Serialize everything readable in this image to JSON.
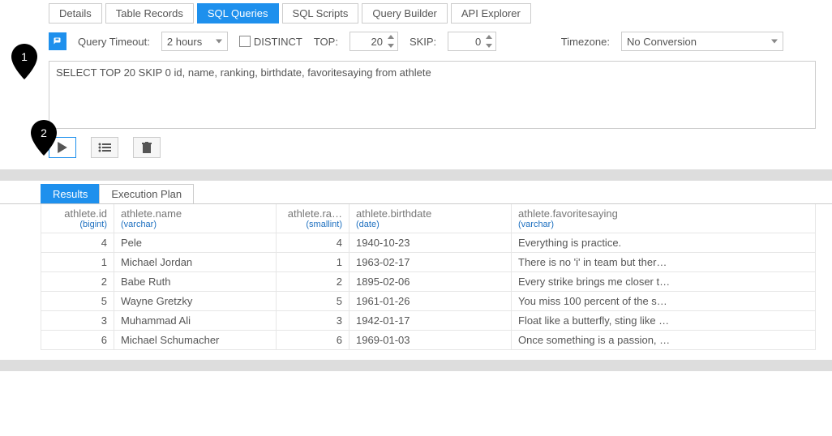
{
  "tabs": {
    "details": "Details",
    "tablerecords": "Table Records",
    "sqlqueries": "SQL Queries",
    "sqlscripts": "SQL Scripts",
    "querybuilder": "Query Builder",
    "apiexplorer": "API Explorer"
  },
  "querybar": {
    "timeout_label": "Query Timeout:",
    "timeout_value": "2 hours",
    "distinct_label": "DISTINCT",
    "top_label": "TOP:",
    "top_value": "20",
    "skip_label": "SKIP:",
    "skip_value": "0",
    "tz_label": "Timezone:",
    "tz_value": "No Conversion"
  },
  "query_text": "SELECT TOP 20 SKIP 0 id, name, ranking, birthdate, favoritesaying from athlete",
  "result_tabs": {
    "results": "Results",
    "explain": "Execution Plan"
  },
  "columns": [
    {
      "name": "athlete.id",
      "type": "(bigint)"
    },
    {
      "name": "athlete.name",
      "type": "(varchar)"
    },
    {
      "name": "athlete.ra…",
      "type": "(smallint)"
    },
    {
      "name": "athlete.birthdate",
      "type": "(date)"
    },
    {
      "name": "athlete.favoritesaying",
      "type": "(varchar)"
    }
  ],
  "rows": [
    {
      "id": "4",
      "name": "Pele",
      "rank": "4",
      "date": "1940-10-23",
      "say": "Everything is practice."
    },
    {
      "id": "1",
      "name": "Michael Jordan",
      "rank": "1",
      "date": "1963-02-17",
      "say": "There is no 'i' in team but ther…"
    },
    {
      "id": "2",
      "name": "Babe Ruth",
      "rank": "2",
      "date": "1895-02-06",
      "say": "Every strike brings me closer t…"
    },
    {
      "id": "5",
      "name": "Wayne Gretzky",
      "rank": "5",
      "date": "1961-01-26",
      "say": "You miss 100 percent of the s…"
    },
    {
      "id": "3",
      "name": "Muhammad Ali",
      "rank": "3",
      "date": "1942-01-17",
      "say": "Float like a butterfly, sting like …"
    },
    {
      "id": "6",
      "name": "Michael Schumacher",
      "rank": "6",
      "date": "1969-01-03",
      "say": "Once something is a passion, …"
    }
  ],
  "callouts": {
    "c1": "1",
    "c2": "2"
  }
}
